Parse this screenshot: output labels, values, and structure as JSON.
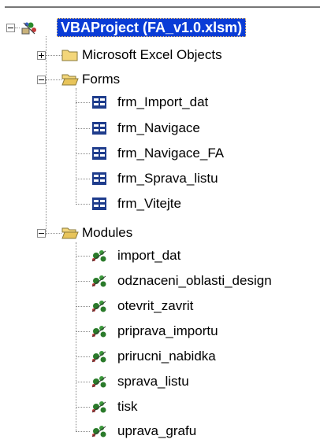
{
  "project": {
    "label": "VBAProject (FA_v1.0.xlsm)",
    "icon": "vba-project-icon",
    "expanded": true
  },
  "folders": [
    {
      "label": "Microsoft Excel Objects",
      "expanded": false,
      "icon": "folder-closed-icon"
    },
    {
      "label": "Forms",
      "expanded": true,
      "icon": "folder-open-icon"
    },
    {
      "label": "Modules",
      "expanded": true,
      "icon": "folder-open-icon"
    }
  ],
  "forms": [
    {
      "label": "frm_Import_dat"
    },
    {
      "label": "frm_Navigace"
    },
    {
      "label": "frm_Navigace_FA"
    },
    {
      "label": "frm_Sprava_listu"
    },
    {
      "label": "frm_Vitejte"
    }
  ],
  "modules": [
    {
      "label": "import_dat"
    },
    {
      "label": "odznaceni_oblasti_design"
    },
    {
      "label": "otevrit_zavrit"
    },
    {
      "label": "priprava_importu"
    },
    {
      "label": "prirucni_nabidka"
    },
    {
      "label": "sprava_listu"
    },
    {
      "label": "tisk"
    },
    {
      "label": "uprava_grafu"
    }
  ],
  "colors": {
    "selection": "#0a3cd6",
    "folder": "#f3d67a",
    "form_icon": "#1e3c8c",
    "module_icon": "#2a7a2a"
  }
}
